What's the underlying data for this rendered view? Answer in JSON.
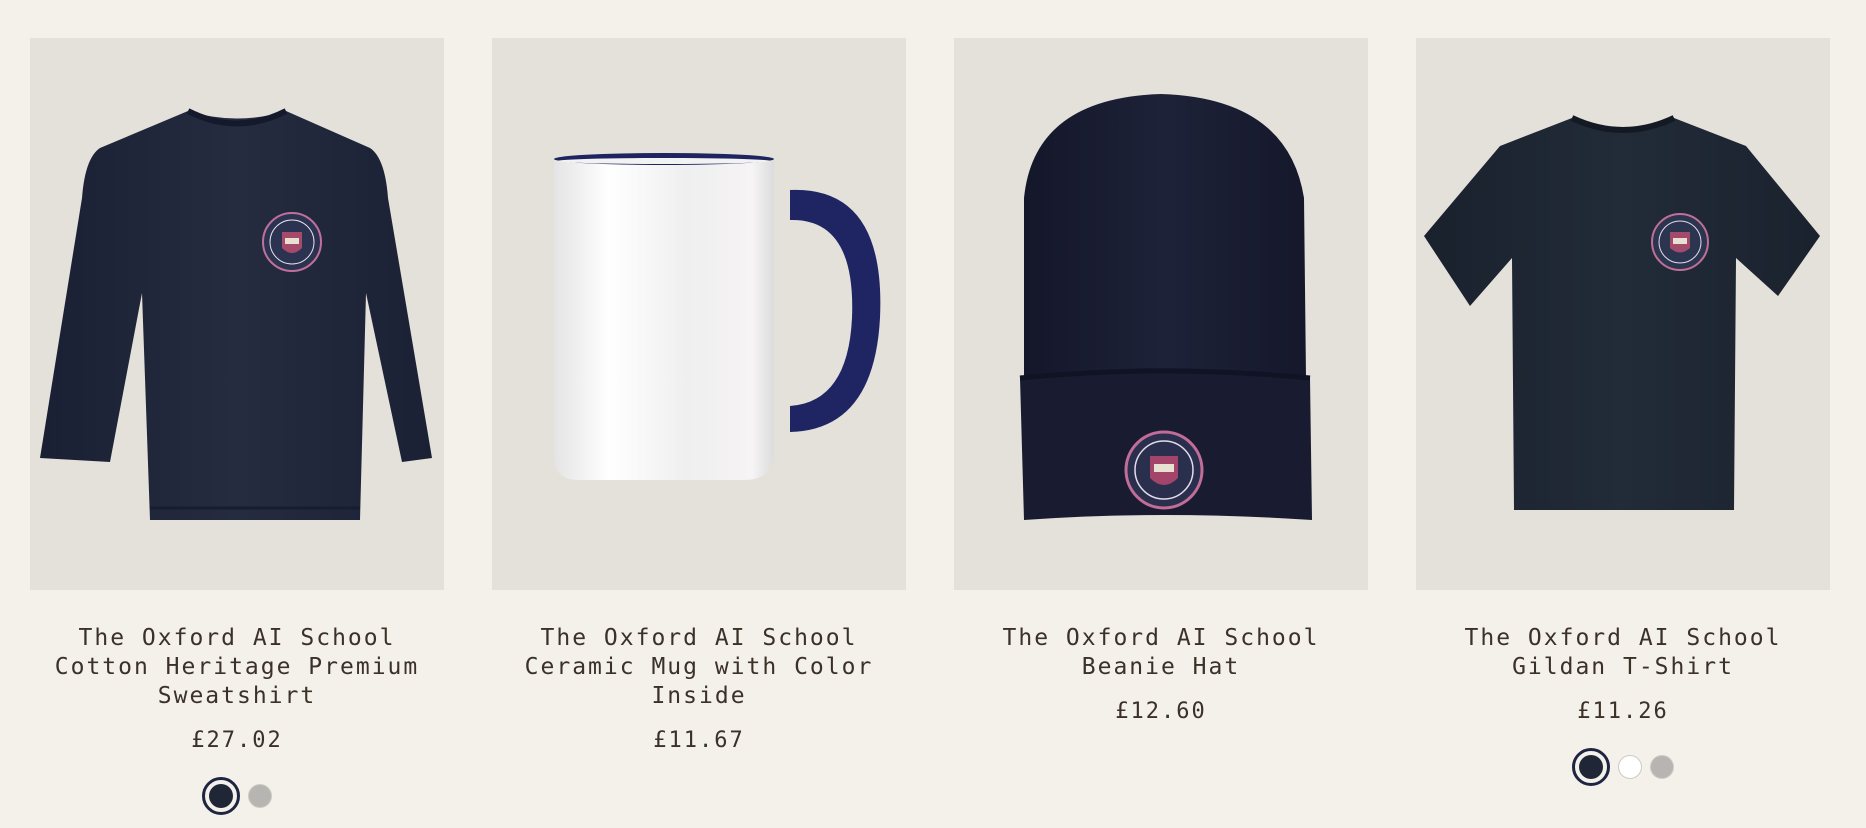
{
  "products": [
    {
      "title": "The Oxford AI School Cotton Heritage Premium Sweatshirt",
      "price": "£27.02",
      "image": "navy-sweatshirt",
      "swatches": [
        {
          "color": "#1f2737",
          "selected": true
        },
        {
          "color": "#b7b5b2",
          "selected": false
        }
      ]
    },
    {
      "title": "The Oxford AI School Ceramic Mug with Color Inside",
      "price": "£11.67",
      "image": "white-mug-navy-handle",
      "swatches": []
    },
    {
      "title": "The Oxford AI School Beanie Hat",
      "price": "£12.60",
      "image": "navy-beanie",
      "swatches": []
    },
    {
      "title": "The Oxford AI School Gildan T-Shirt",
      "price": "£11.26",
      "image": "navy-tshirt",
      "swatches": [
        {
          "color": "#1f2737",
          "selected": true
        },
        {
          "color": "#ffffff",
          "selected": false
        },
        {
          "color": "#b7b5b2",
          "selected": false
        }
      ]
    }
  ]
}
